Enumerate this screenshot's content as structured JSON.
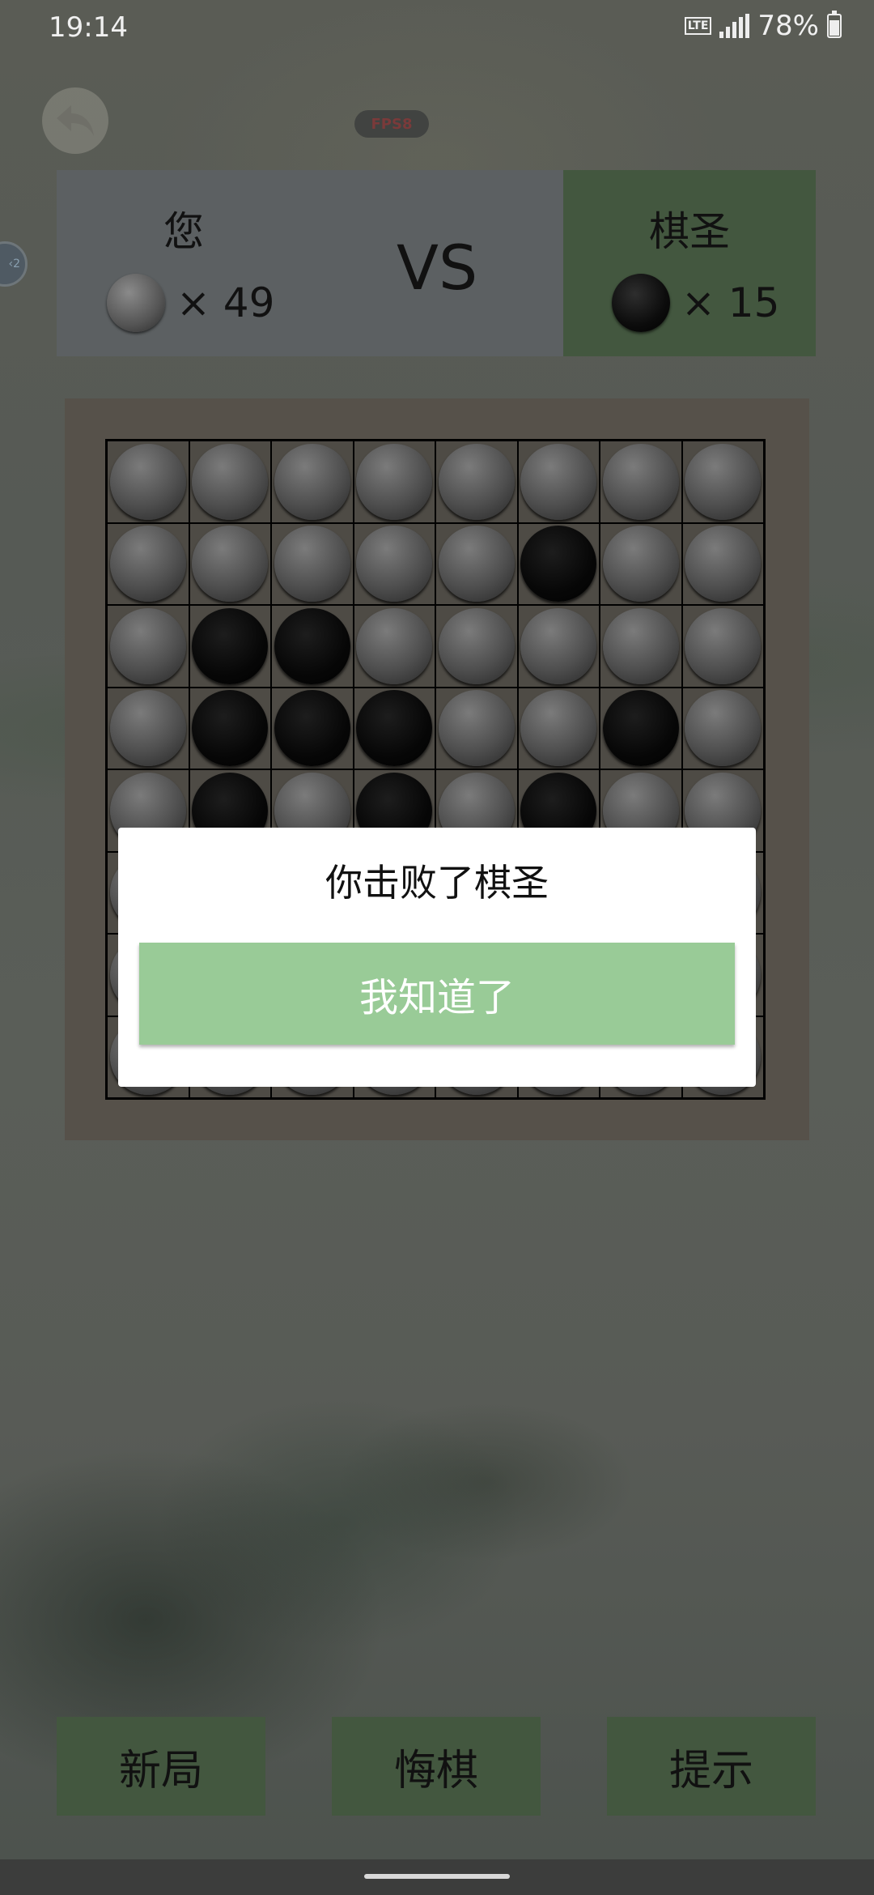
{
  "status": {
    "time": "19:14",
    "network": "LTE",
    "battery_pct": "78%",
    "battery_level": 0.78
  },
  "top": {
    "back_icon": "undo-arrow-icon",
    "fps_label": "FPS8"
  },
  "score": {
    "player_name": "您",
    "player_count": "× 49",
    "vs": "VS",
    "opponent_name": "棋圣",
    "opponent_count": "× 15",
    "colors": {
      "player_panel": "#5c6062",
      "opponent_panel": "#43573f"
    }
  },
  "board": {
    "rows": [
      "gggggggg",
      "gggggbgg",
      "gbbggggg",
      "gbbbggbg",
      "gbgbgbgg",
      "gggggggg",
      "gggggggg",
      "gggggggg"
    ]
  },
  "dialog": {
    "message": "你击败了棋圣",
    "confirm": "我知道了",
    "confirm_color": "#99cb97"
  },
  "controls": {
    "new_game": "新局",
    "undo": "悔棋",
    "hint": "提示"
  }
}
